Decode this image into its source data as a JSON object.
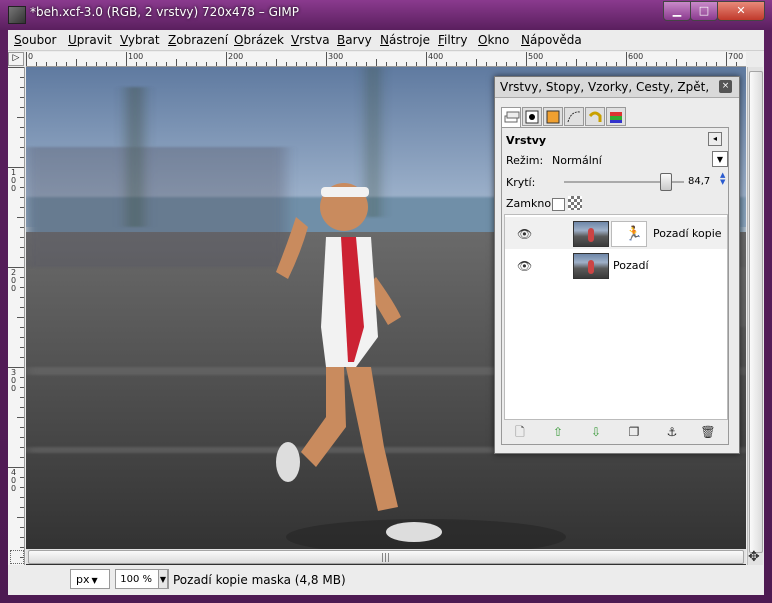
{
  "window": {
    "title": "*beh.xcf-3.0 (RGB, 2 vrstvy) 720x478 – GIMP",
    "min_glyph": "▁",
    "max_glyph": "□",
    "close_glyph": "✕"
  },
  "menu": [
    {
      "accel": "S",
      "rest": "oubor"
    },
    {
      "accel": "U",
      "rest": "pravit"
    },
    {
      "accel": "V",
      "rest": "ybrat"
    },
    {
      "accel": "Z",
      "rest": "obrazení"
    },
    {
      "accel": "O",
      "rest": "brázek"
    },
    {
      "accel": "V",
      "rest": "rstva"
    },
    {
      "accel": "B",
      "rest": "arvy"
    },
    {
      "accel": "N",
      "rest": "ástroje"
    },
    {
      "accel": "F",
      "rest": "iltry"
    },
    {
      "accel": "O",
      "rest": "kno"
    },
    {
      "accel": "N",
      "rest": "ápověda"
    }
  ],
  "rulers": {
    "corner_glyph": "▷",
    "h_labels": [
      "0",
      "100",
      "200",
      "300",
      "400",
      "500",
      "600",
      "700"
    ],
    "v_labels": [
      "1\n0\n0",
      "2\n0\n0",
      "3\n0\n0",
      "4\n0\n0"
    ]
  },
  "image": {
    "sky_color": "#7d98bd",
    "sea_color": "#6f8fa8",
    "road_color": "#4a4a4a",
    "skin_color": "#c98b5e",
    "suit_primary": "#f2f2f2",
    "suit_accent": "#cc2233"
  },
  "status": {
    "unit": "px",
    "unit_arrow": "▼",
    "zoom": "100 %",
    "zoom_arrow": "▼",
    "message": "Pozadí kopie maska (4,8 MB)"
  },
  "scroll": {
    "h_grip": "|||",
    "nav_glyph": "✥"
  },
  "dock": {
    "title": "Vrstvy, Stopy, Vzorky, Cesty, Zpět, Kan...",
    "close_glyph": "×",
    "tab_icons": [
      "layers-tab-icon",
      "channels-tab-icon",
      "paths-tab-icon",
      "patterns-tab-icon",
      "undo-tab-icon",
      "brushes-tab-icon"
    ],
    "panel_title": "Vrstvy",
    "panel_menu_glyph": "◂",
    "mode_label": "Režim:",
    "mode_value": "Normální",
    "mode_arrow": "▼",
    "opacity_label": "Krytí:",
    "opacity_value": "84,7",
    "opacity_fraction": 0.847,
    "spin_glyph": "▲\n▼",
    "lock_label": "Zamknout:",
    "layers": [
      {
        "name": "Pozadí kopie",
        "has_mask": true,
        "selected": true
      },
      {
        "name": "Pozadí",
        "has_mask": false,
        "selected": false
      }
    ],
    "eye_glyph": "👁",
    "mask_glyph": "🏃",
    "tools": [
      {
        "name": "new-layer-button",
        "glyph": "🗋",
        "color": "#555555"
      },
      {
        "name": "raise-layer-button",
        "glyph": "⇧",
        "color": "#3a9a3a"
      },
      {
        "name": "lower-layer-button",
        "glyph": "⇩",
        "color": "#3a9a3a"
      },
      {
        "name": "duplicate-layer-button",
        "glyph": "❐",
        "color": "#333333"
      },
      {
        "name": "anchor-layer-button",
        "glyph": "⚓",
        "color": "#333333"
      },
      {
        "name": "delete-layer-button",
        "glyph": "🗑",
        "color": "#333333"
      }
    ]
  }
}
